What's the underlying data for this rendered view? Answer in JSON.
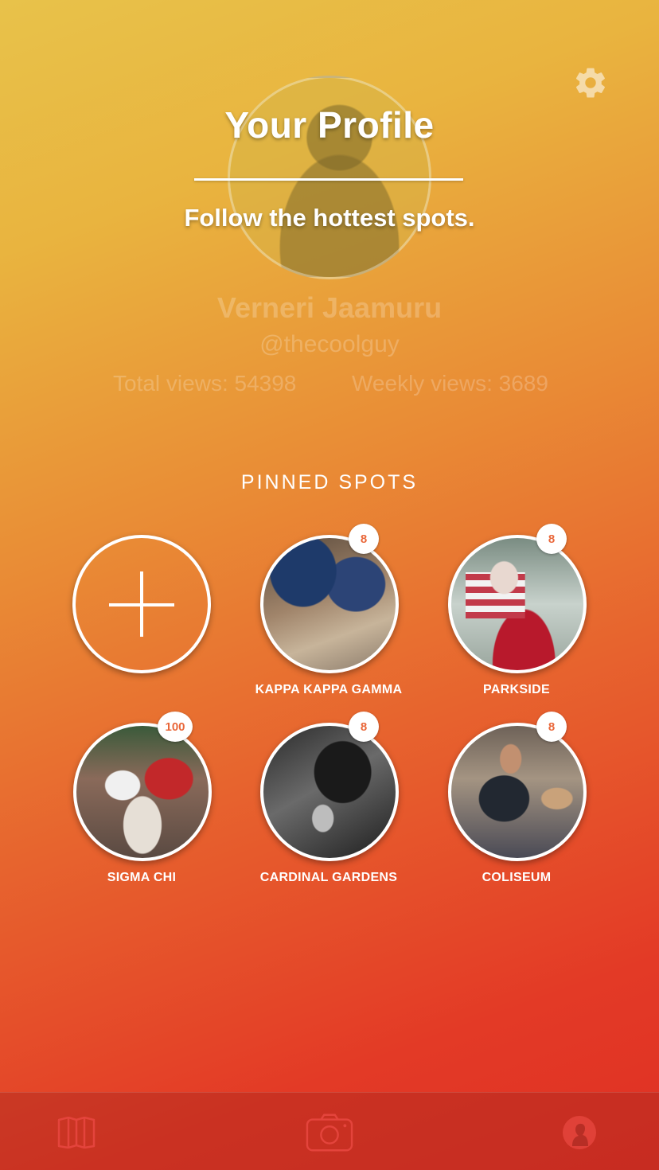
{
  "header": {
    "title": "Your Profile",
    "subtitle": "Follow the hottest spots.",
    "settings_icon": "gear-icon"
  },
  "profile": {
    "name": "Verneri Jaamuru",
    "handle": "@thecoolguy",
    "total_views_label": "Total views: 54398",
    "weekly_views_label": "Weekly views: 3689"
  },
  "pinned": {
    "title": "PINNED SPOTS",
    "add_icon": "plus-icon",
    "spots": [
      {
        "label": "KAPPA KAPPA GAMMA",
        "count": "8"
      },
      {
        "label": "PARKSIDE",
        "count": "8"
      },
      {
        "label": "SIGMA CHI",
        "count": "100"
      },
      {
        "label": "CARDINAL GARDENS",
        "count": "8"
      },
      {
        "label": "COLISEUM",
        "count": "8"
      }
    ]
  },
  "tabbar": {
    "tabs": [
      {
        "icon": "map-icon"
      },
      {
        "icon": "camera-icon"
      },
      {
        "icon": "profile-icon"
      }
    ]
  },
  "colors": {
    "gradient_top": "#e8c24a",
    "gradient_bottom": "#df3024",
    "badge_text": "#e9673a"
  }
}
